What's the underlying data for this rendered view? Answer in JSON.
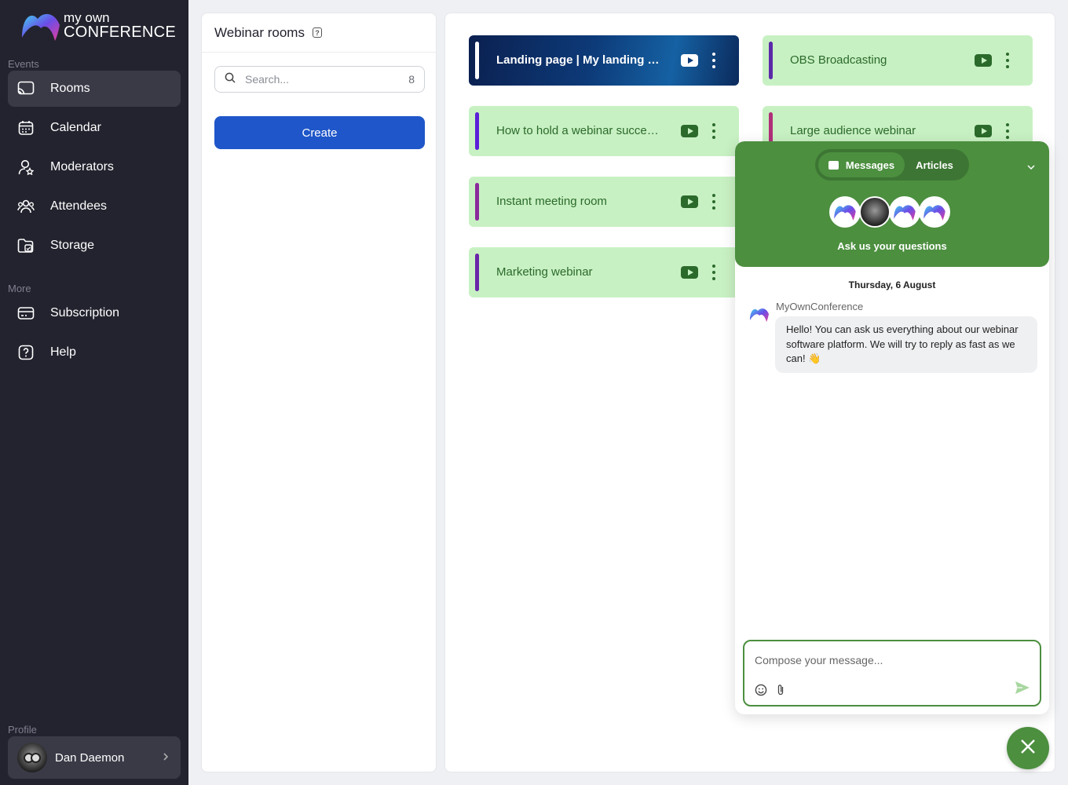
{
  "brand": {
    "line1": "my own",
    "line2": "CONFERENCE"
  },
  "sidebar": {
    "events_label": "Events",
    "more_label": "More",
    "profile_label": "Profile",
    "items": [
      {
        "label": "Rooms",
        "icon": "cast-icon",
        "active": true
      },
      {
        "label": "Calendar",
        "icon": "calendar-icon"
      },
      {
        "label": "Moderators",
        "icon": "moderator-icon"
      },
      {
        "label": "Attendees",
        "icon": "attendees-icon"
      },
      {
        "label": "Storage",
        "icon": "storage-icon"
      }
    ],
    "more_items": [
      {
        "label": "Subscription",
        "icon": "card-icon"
      },
      {
        "label": "Help",
        "icon": "help-icon"
      }
    ],
    "profile_name": "Dan Daemon"
  },
  "rooms_panel": {
    "title": "Webinar rooms",
    "search_placeholder": "Search...",
    "count": "8",
    "create_label": "Create"
  },
  "rooms": [
    {
      "title": "Landing page  |  My landing page",
      "bar_color": "#ffffff",
      "style": "dark"
    },
    {
      "title": "OBS Broadcasting",
      "bar_color": "#5b2aa8"
    },
    {
      "title": "How to hold a webinar successfully",
      "bar_color": "#5b1fd8"
    },
    {
      "title": "Large audience webinar",
      "bar_color": "#b0307a"
    },
    {
      "title": "Instant meeting room",
      "bar_color": "#8a2a9b"
    },
    {
      "title": "Marketing webinar",
      "bar_color": "#6a25a8"
    }
  ],
  "chat": {
    "tab_messages": "Messages",
    "tab_articles": "Articles",
    "ask_text": "Ask us your questions",
    "date": "Thursday, 6 August",
    "sender": "MyOwnConference",
    "message": "Hello! You can ask us everything about our webinar software platform. We will try to reply as fast as we can! 👋",
    "compose_placeholder": "Compose your message..."
  },
  "colors": {
    "sidebar_bg": "#23232f",
    "accent_blue": "#1f56c9",
    "chat_green": "#4c8f3f",
    "card_green": "#c8f1c3"
  }
}
